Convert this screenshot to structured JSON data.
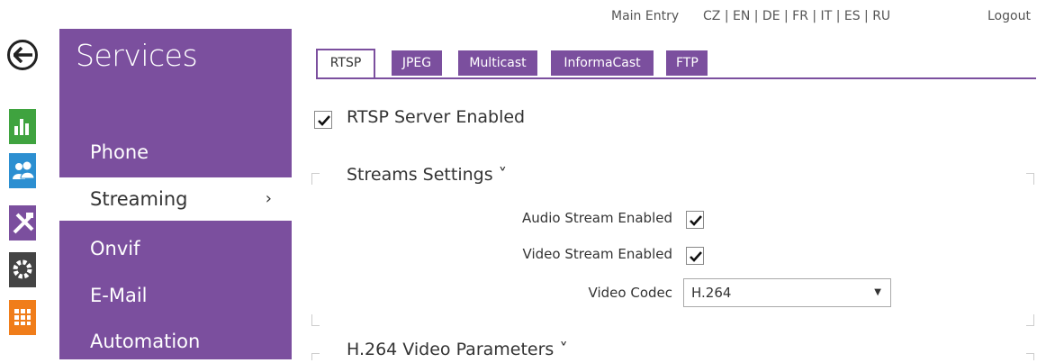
{
  "topbar": {
    "main_entry": "Main Entry",
    "languages": "CZ | EN | DE | FR | IT | ES | RU",
    "logout": "Logout"
  },
  "sidebar_icons": [
    {
      "name": "status-icon",
      "color": "#3fa33f"
    },
    {
      "name": "directory-icon",
      "color": "#2c8fd1"
    },
    {
      "name": "hardware-icon",
      "color": "#7b4f9e"
    },
    {
      "name": "system-icon",
      "color": "#444444"
    },
    {
      "name": "services-icon",
      "color": "#f07d1a"
    }
  ],
  "menu": {
    "title": "Services",
    "items": [
      {
        "label": "Phone"
      },
      {
        "label": "Streaming",
        "chevron": "›"
      },
      {
        "label": "Onvif"
      },
      {
        "label": "E-Mail"
      },
      {
        "label": "Automation"
      }
    ]
  },
  "tabs": [
    {
      "label": "RTSP"
    },
    {
      "label": "JPEG"
    },
    {
      "label": "Multicast"
    },
    {
      "label": "InformaCast"
    },
    {
      "label": "FTP"
    }
  ],
  "rtsp": {
    "server_enabled_label": "RTSP Server Enabled",
    "server_enabled": true
  },
  "streams": {
    "title": "Streams Settings ˅",
    "audio_label": "Audio Stream Enabled",
    "audio_enabled": true,
    "video_label": "Video Stream Enabled",
    "video_enabled": true,
    "codec_label": "Video Codec",
    "codec_value": "H.264",
    "codec_arrow": "▼"
  },
  "h264": {
    "title": "H.264 Video Parameters ˅"
  },
  "colors": {
    "accent": "#7b4f9e"
  }
}
